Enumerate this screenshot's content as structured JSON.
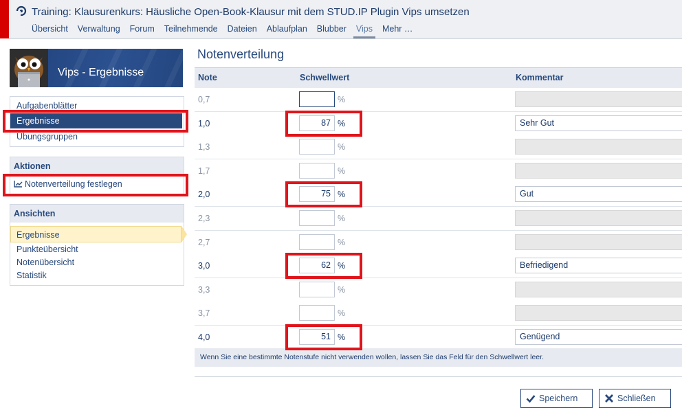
{
  "course": {
    "title": "Training: Klausurenkurs: Häusliche Open-Book-Klausur mit dem STUD.IP Plugin Vips umsetzen"
  },
  "nav": [
    "Übersicht",
    "Verwaltung",
    "Forum",
    "Teilnehmende",
    "Dateien",
    "Ablaufplan",
    "Blubber",
    "Vips",
    "Mehr …"
  ],
  "sidebar": {
    "title": "Vips - Ergebnisse",
    "nav_items": [
      "Aufgabenblätter",
      "Ergebnisse",
      "Übungsgruppen"
    ],
    "actions_header": "Aktionen",
    "action_item": "Notenverteilung festlegen",
    "views_header": "Ansichten",
    "view_items": [
      "Ergebnisse",
      "Punkteübersicht",
      "Notenübersicht",
      "Statistik"
    ]
  },
  "main": {
    "title": "Notenverteilung",
    "columns": [
      "Note",
      "Schwellwert",
      "Kommentar"
    ],
    "percent_sign": "%",
    "rows": [
      {
        "note": "0,7",
        "threshold": "",
        "comment": ""
      },
      {
        "note": "1,0",
        "threshold": "87",
        "comment": "Sehr Gut"
      },
      {
        "note": "1,3",
        "threshold": "",
        "comment": ""
      },
      {
        "note": "1,7",
        "threshold": "",
        "comment": ""
      },
      {
        "note": "2,0",
        "threshold": "75",
        "comment": "Gut"
      },
      {
        "note": "2,3",
        "threshold": "",
        "comment": ""
      },
      {
        "note": "2,7",
        "threshold": "",
        "comment": ""
      },
      {
        "note": "3,0",
        "threshold": "62",
        "comment": "Befriedigend"
      },
      {
        "note": "3,3",
        "threshold": "",
        "comment": ""
      },
      {
        "note": "3,7",
        "threshold": "",
        "comment": ""
      },
      {
        "note": "4,0",
        "threshold": "51",
        "comment": "Genügend"
      }
    ],
    "footnote": "Wenn Sie eine bestimmte Notenstufe nicht verwenden wollen, lassen Sie das Feld für den Schwellwert leer."
  },
  "buttons": {
    "save": "Speichern",
    "close": "Schließen"
  },
  "colors": {
    "accent": "#28497c",
    "highlight": "#e1141b",
    "brand_bar": "#d60000"
  }
}
